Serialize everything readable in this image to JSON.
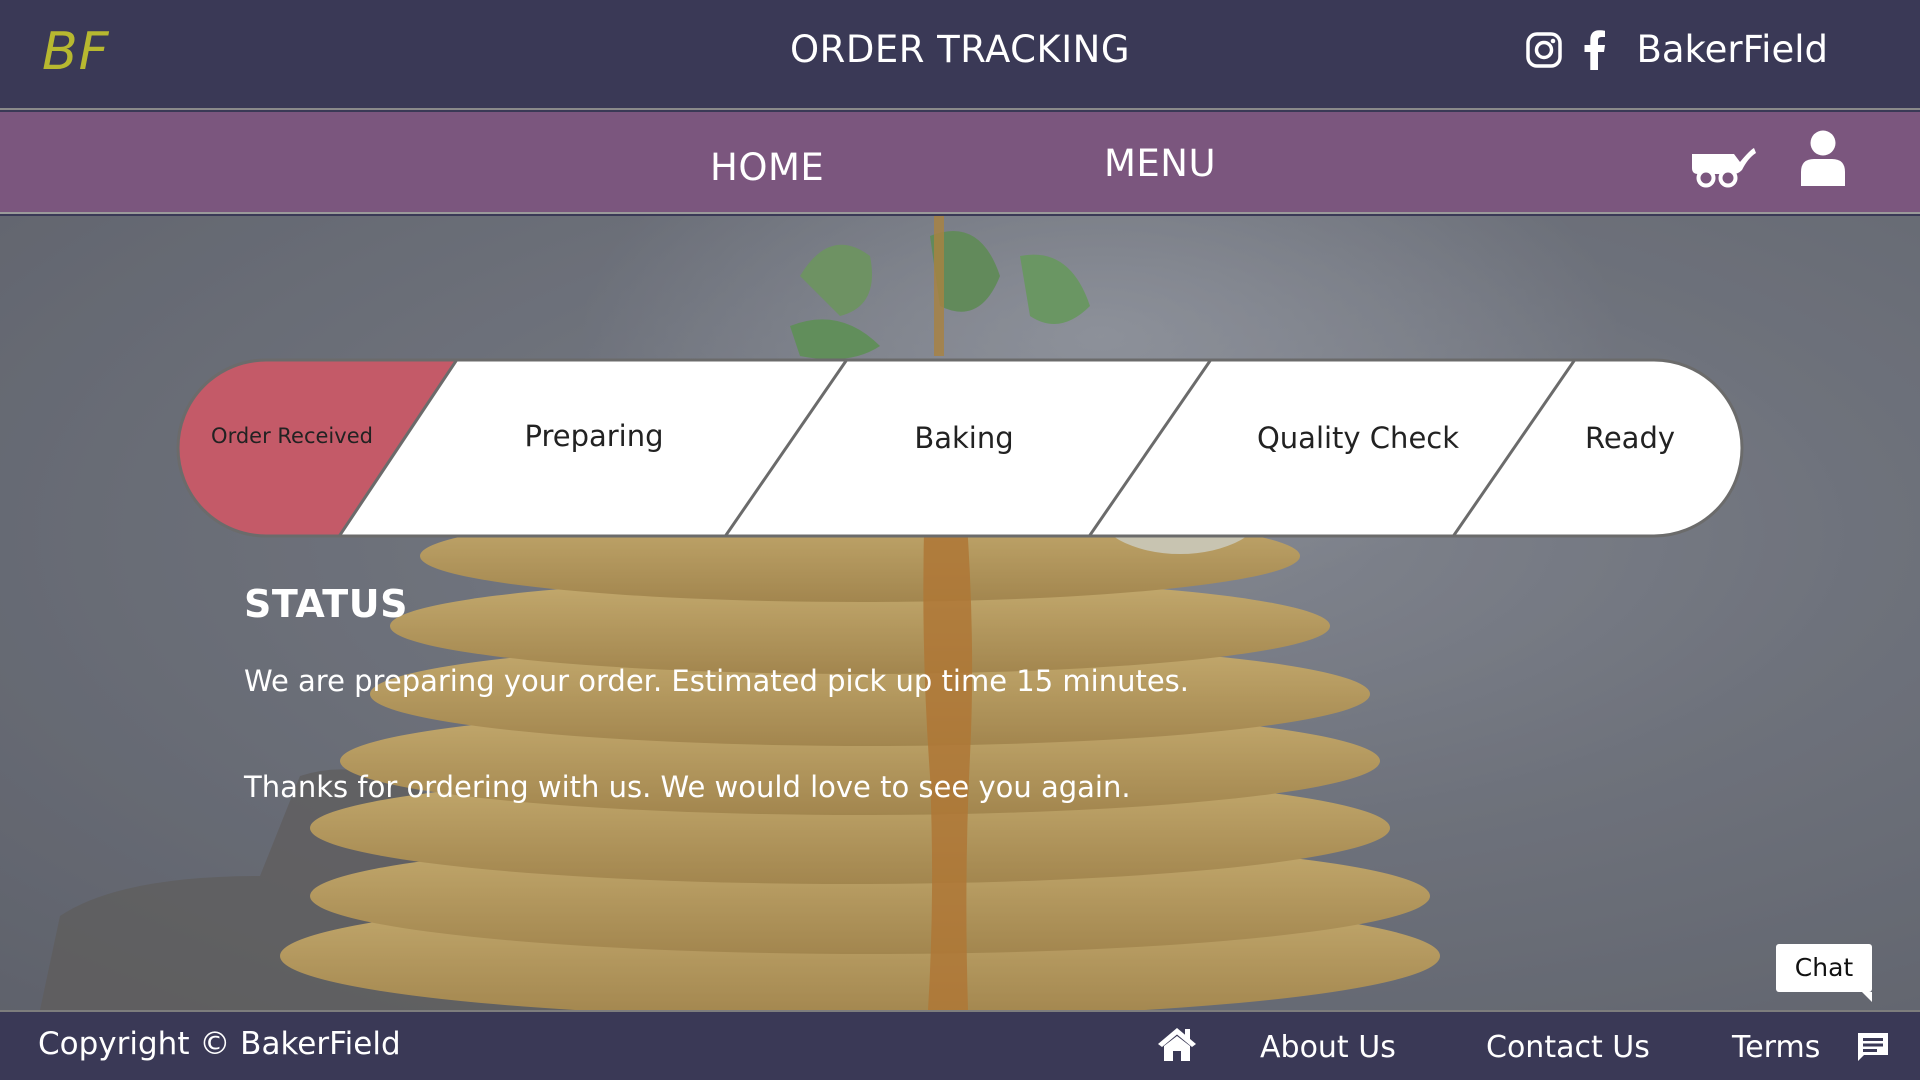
{
  "header": {
    "logo": "BF",
    "title": "ORDER TRACKING",
    "brand": "BakerField",
    "social_icons": [
      "instagram-icon",
      "facebook-icon"
    ]
  },
  "nav": {
    "home": "HOME",
    "menu": "MENU",
    "icons": [
      "cart-icon",
      "user-icon"
    ]
  },
  "progress": {
    "steps": [
      {
        "label": "Order Received",
        "active": true
      },
      {
        "label": "Preparing",
        "active": false
      },
      {
        "label": "Baking",
        "active": false
      },
      {
        "label": "Quality Check",
        "active": false
      },
      {
        "label": "Ready",
        "active": false
      }
    ],
    "active_color": "#c45a68"
  },
  "status": {
    "title": "STATUS",
    "message": "We are preparing your order. Estimated pick up time 15 minutes.",
    "thanks": "Thanks for ordering with us. We would love to see you again."
  },
  "chat": {
    "label": "Chat"
  },
  "footer": {
    "copyright": "Copyright  © BakerField",
    "links": [
      "About Us",
      "Contact Us",
      "Terms"
    ],
    "icons": [
      "home-icon",
      "chat-bubble-icon"
    ]
  },
  "colors": {
    "header_bg": "#3a3956",
    "nav_bg": "#7b567e",
    "logo": "#b7b830",
    "active_step": "#c45a68"
  }
}
